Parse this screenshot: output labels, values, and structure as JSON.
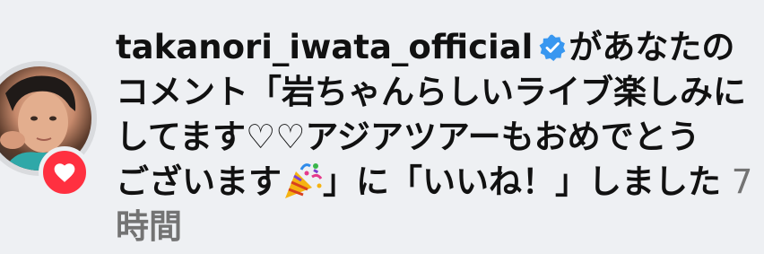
{
  "notification": {
    "username": "takanori_iwata_official",
    "verified_icon": "verified-badge-icon",
    "accent_color": "#3897f0",
    "line1_suffix": "があなたの",
    "line2": "コメント「岩ちゃんらしいライブ楽しみに",
    "line3": "してます♡♡アジアツアーもおめでとう",
    "line4_start": "ございます",
    "party_icon": "party-popper-icon",
    "line4_end": "」に「いいね！」しました",
    "time_prefix": " 7",
    "time_unit": "時間",
    "heart_badge_color": "#ff3040",
    "heart_icon": "heart-icon",
    "avatar_icon": "profile-avatar"
  }
}
